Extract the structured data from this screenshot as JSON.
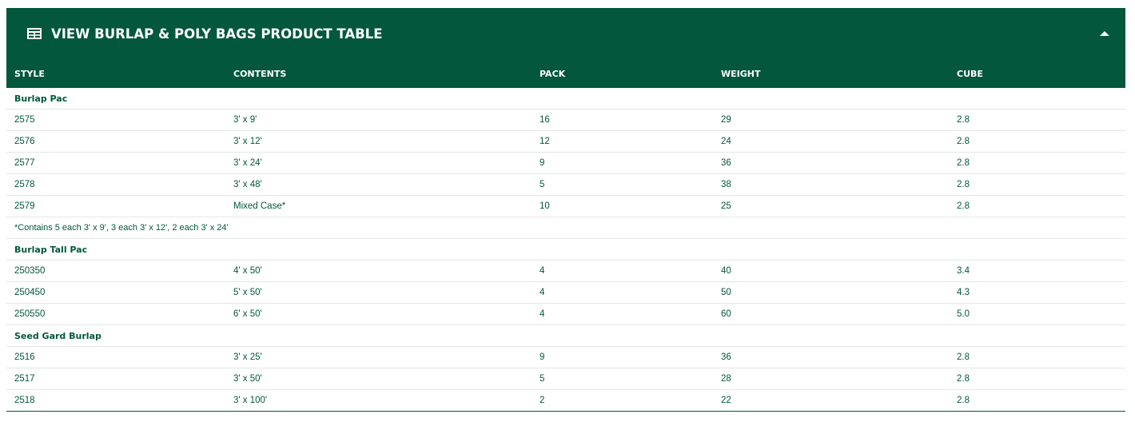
{
  "header": {
    "title": "VIEW BURLAP & POLY BAGS PRODUCT TABLE",
    "icon": "table-icon",
    "toggle_icon": "caret-up-icon",
    "color": "#02573c"
  },
  "table": {
    "columns": [
      "STYLE",
      "CONTENTS",
      "PACK",
      "WEIGHT",
      "CUBE"
    ],
    "groups": [
      {
        "name": "Burlap Pac",
        "rows": [
          [
            "2575",
            "3' x 9'",
            "16",
            "29",
            "2.8"
          ],
          [
            "2576",
            "3' x 12'",
            "12",
            "24",
            "2.8"
          ],
          [
            "2577",
            "3' x 24'",
            "9",
            "36",
            "2.8"
          ],
          [
            "2578",
            "3' x 48'",
            "5",
            "38",
            "2.8"
          ],
          [
            "2579",
            "Mixed Case*",
            "10",
            "25",
            "2.8"
          ]
        ],
        "note": "*Contains 5 each 3' x 9', 3 each 3' x 12', 2 each 3' x 24'"
      },
      {
        "name": "Burlap Tall Pac",
        "rows": [
          [
            "250350",
            "4' x 50'",
            "4",
            "40",
            "3.4"
          ],
          [
            "250450",
            "5' x 50'",
            "4",
            "50",
            "4.3"
          ],
          [
            "250550",
            "6' x 50'",
            "4",
            "60",
            "5.0"
          ]
        ]
      },
      {
        "name": "Seed Gard Burlap",
        "rows": [
          [
            "2516",
            "3' x 25'",
            "9",
            "36",
            "2.8"
          ],
          [
            "2517",
            "3' x 50'",
            "5",
            "28",
            "2.8"
          ],
          [
            "2518",
            "3' x 100'",
            "2",
            "22",
            "2.8"
          ]
        ]
      }
    ]
  }
}
